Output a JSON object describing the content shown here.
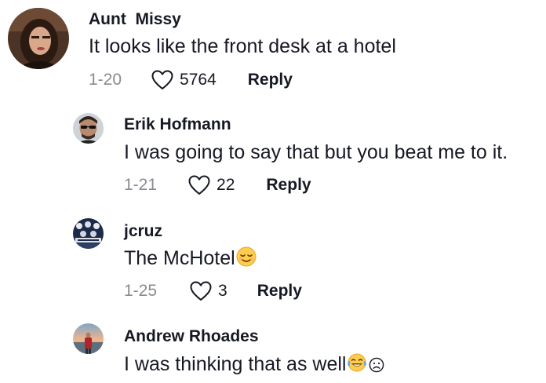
{
  "comments": [
    {
      "username": "Aunt  Missy",
      "text": "It looks like the front desk at a hotel",
      "date": "1-20",
      "likes": "5764",
      "reply_label": "Reply",
      "avatar_icon": "profile-photo-woman"
    },
    {
      "username": "Erik Hofmann",
      "text": "I was going to say that but you beat me to it.",
      "date": "1-21",
      "likes": "22",
      "reply_label": "Reply",
      "avatar_icon": "profile-photo-man-sunglasses"
    },
    {
      "username": "jcruz",
      "text": "The McHotel",
      "text_emoji": "relieved-face-emoji",
      "date": "1-25",
      "likes": "3",
      "reply_label": "Reply",
      "avatar_icon": "profile-photo-crowd"
    },
    {
      "username": "Andrew Rhoades",
      "text": "I was thinking that as well",
      "text_emoji": [
        "tears-of-joy-emoji",
        "frowning-face-emoji"
      ],
      "avatar_icon": "profile-photo-sunset"
    }
  ],
  "colors": {
    "text": "#161823",
    "muted": "#8a8b91",
    "background": "#ffffff"
  },
  "icons": {
    "like": "heart-outline-icon"
  }
}
